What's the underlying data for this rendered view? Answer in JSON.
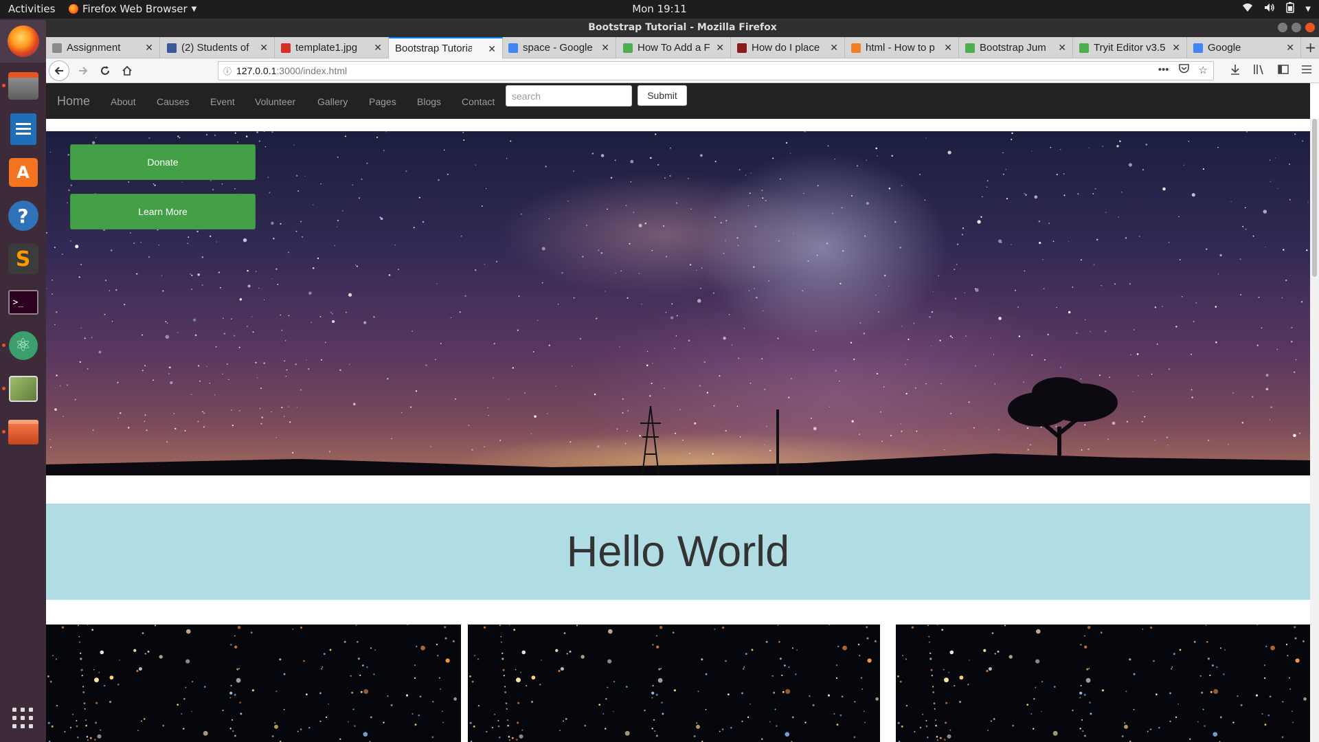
{
  "topbar": {
    "activities": "Activities",
    "app_menu": "Firefox Web Browser",
    "clock": "Mon 19:11"
  },
  "window": {
    "title": "Bootstrap Tutorial - Mozilla Firefox"
  },
  "tabs": [
    {
      "label": "Assignment",
      "icon": "globe-icon",
      "color": "#8a8a8a"
    },
    {
      "label": "(2) Students of",
      "icon": "facebook-icon",
      "color": "#3b5998"
    },
    {
      "label": "template1.jpg",
      "icon": "image-icon",
      "color": "#d93025"
    },
    {
      "label": "Bootstrap Tutorial",
      "icon": "none",
      "color": "#ffffff",
      "active": true
    },
    {
      "label": "space - Google",
      "icon": "google-icon",
      "color": "#4285f4"
    },
    {
      "label": "How To Add a F",
      "icon": "w3schools-icon",
      "color": "#4caf50"
    },
    {
      "label": "How do I place",
      "icon": "page-icon",
      "color": "#8b1a1a"
    },
    {
      "label": "html - How to p",
      "icon": "stackoverflow-icon",
      "color": "#f48024"
    },
    {
      "label": "Bootstrap Jum",
      "icon": "w3schools-icon",
      "color": "#4caf50"
    },
    {
      "label": "Tryit Editor v3.5",
      "icon": "w3schools-icon",
      "color": "#4caf50"
    },
    {
      "label": "Google",
      "icon": "google-icon",
      "color": "#4285f4"
    }
  ],
  "address": {
    "host": "127.0.0.1",
    "path": ":3000/index.html"
  },
  "site": {
    "brand": "Home",
    "nav": [
      "About",
      "Causes",
      "Event",
      "Volunteer",
      "Gallery",
      "Pages",
      "Blogs",
      "Contact"
    ],
    "search_placeholder": "search",
    "submit_label": "Submit",
    "donate_label": "Donate",
    "learn_more_label": "Learn More",
    "jumbotron_title": "Hello World"
  },
  "colors": {
    "hero_button": "#43a047",
    "jumbotron_bg": "#b0dde4",
    "navbar_bg": "#222222",
    "ubuntu_accent": "#e95420"
  },
  "dock": [
    "firefox-icon",
    "files-icon",
    "writer-icon",
    "software-center-icon",
    "help-icon",
    "sublime-icon",
    "terminal-icon",
    "atom-icon",
    "gimp-icon",
    "archive-icon",
    "show-apps-icon"
  ]
}
